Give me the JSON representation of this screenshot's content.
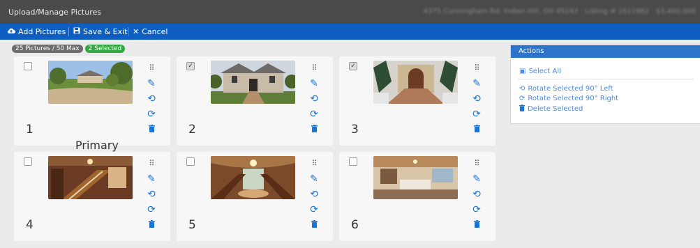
{
  "window": {
    "title": "Upload/Manage Pictures",
    "address_text": "4375 Cunningham Rd, Indian Hill, OH 45243 · Listing # 1611962 · $3,400,000"
  },
  "toolbar": {
    "add_label": "Add Pictures",
    "save_label": "Save & Exit",
    "cancel_label": "Cancel"
  },
  "counts": {
    "pictures": "25 Pictures / 50 Max",
    "selected": "2 Selected"
  },
  "pictures": [
    {
      "number": "1",
      "checked": false,
      "primary_label": "Primary"
    },
    {
      "number": "2",
      "checked": true
    },
    {
      "number": "3",
      "checked": true
    },
    {
      "number": "4",
      "checked": false
    },
    {
      "number": "5",
      "checked": false
    },
    {
      "number": "6",
      "checked": false
    }
  ],
  "icons": {
    "drag": "drag-handle-icon",
    "edit": "pencil-icon",
    "rotate_left": "rotate-left-icon",
    "rotate_right": "rotate-right-icon",
    "delete": "trash-icon"
  },
  "actions": {
    "title": "Actions",
    "select_all": "Select All",
    "rotate_left": "Rotate Selected 90° Left",
    "rotate_right": "Rotate Selected 90° Right",
    "delete": "Delete Selected"
  },
  "colors": {
    "accent": "#0f5fc3",
    "selected_badge": "#35a844",
    "link": "#4c89d8"
  }
}
